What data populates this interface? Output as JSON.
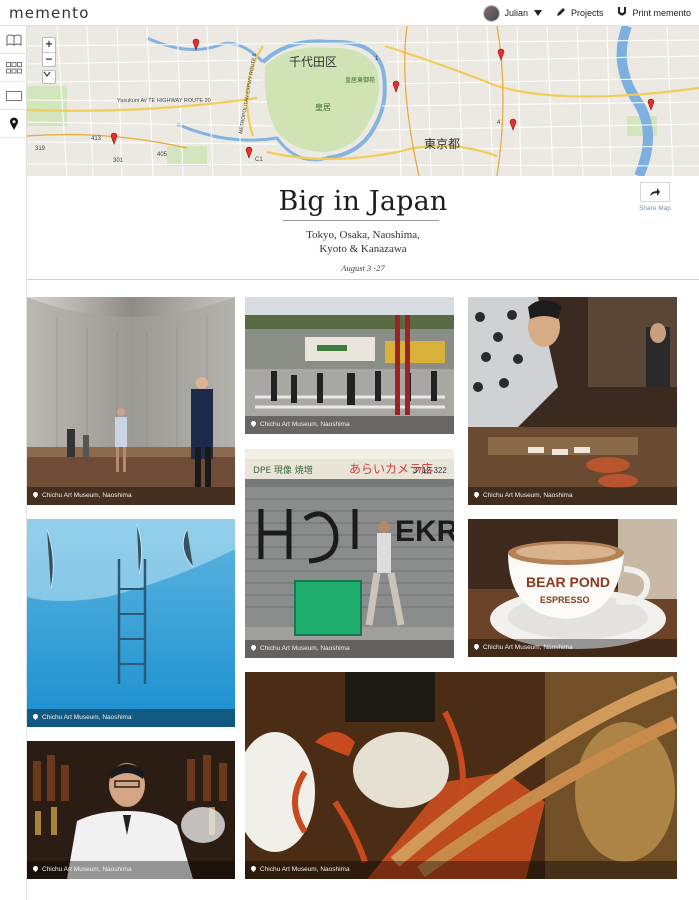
{
  "app": {
    "logo": "memento"
  },
  "nav": {
    "user": "Julian",
    "projects": "Projects",
    "print": "Print memento"
  },
  "sidebar": {
    "icons": [
      "book-icon",
      "grid-icon",
      "single-view-icon",
      "location-pin-icon"
    ]
  },
  "map": {
    "labels": {
      "chiyoda": "千代田区",
      "tokyo": "東京都",
      "kokyo": "皇居東御苑",
      "imperial": "皇居",
      "route20": "Yasukuni Av TE HIGHWAY ROUTE 20",
      "route5": "METROPOLITAN EXPWY ROUTE 5",
      "c1": "C1",
      "r413": "413",
      "r301": "301",
      "r319": "319",
      "r405": "405",
      "r1": "1",
      "r4": "4"
    },
    "marker_count": 8
  },
  "trip": {
    "title": "Big in Japan",
    "places_line1": "Tokyo, Osaka, Naoshima,",
    "places_line2": "Kyoto & Kanazawa",
    "dates": "August 3 -27",
    "share_label": "Share Map"
  },
  "photos": [
    {
      "caption": "Chichu Art Museum, Naoshima",
      "scene": "museum-atrium"
    },
    {
      "caption": "Chichu Art Museum, Naoshima",
      "scene": "street-crossing"
    },
    {
      "caption": "Chichu Art Museum, Naoshima",
      "scene": "restaurant-chef"
    },
    {
      "caption": "Chichu Art Museum, Naoshima",
      "scene": "swimming-pool"
    },
    {
      "caption": "Chichu Art Museum, Naoshima",
      "scene": "graffiti-shutter"
    },
    {
      "caption": "Chichu Art Museum, Naoshima",
      "scene": "bear-pond-coffee"
    },
    {
      "caption": "Chichu Art Museum, Naoshima",
      "scene": "bartender"
    },
    {
      "caption": "Chichu Art Museum, Naoshima",
      "scene": "crab-chopsticks"
    }
  ],
  "street_signs": {
    "store": "あらいカメラ店",
    "phone": "3712-322",
    "banner": "DPE 現像 焼増",
    "cup_line1": "BEAR POND",
    "cup_line2": "ESPRESSO",
    "graffiti": "EKR"
  }
}
